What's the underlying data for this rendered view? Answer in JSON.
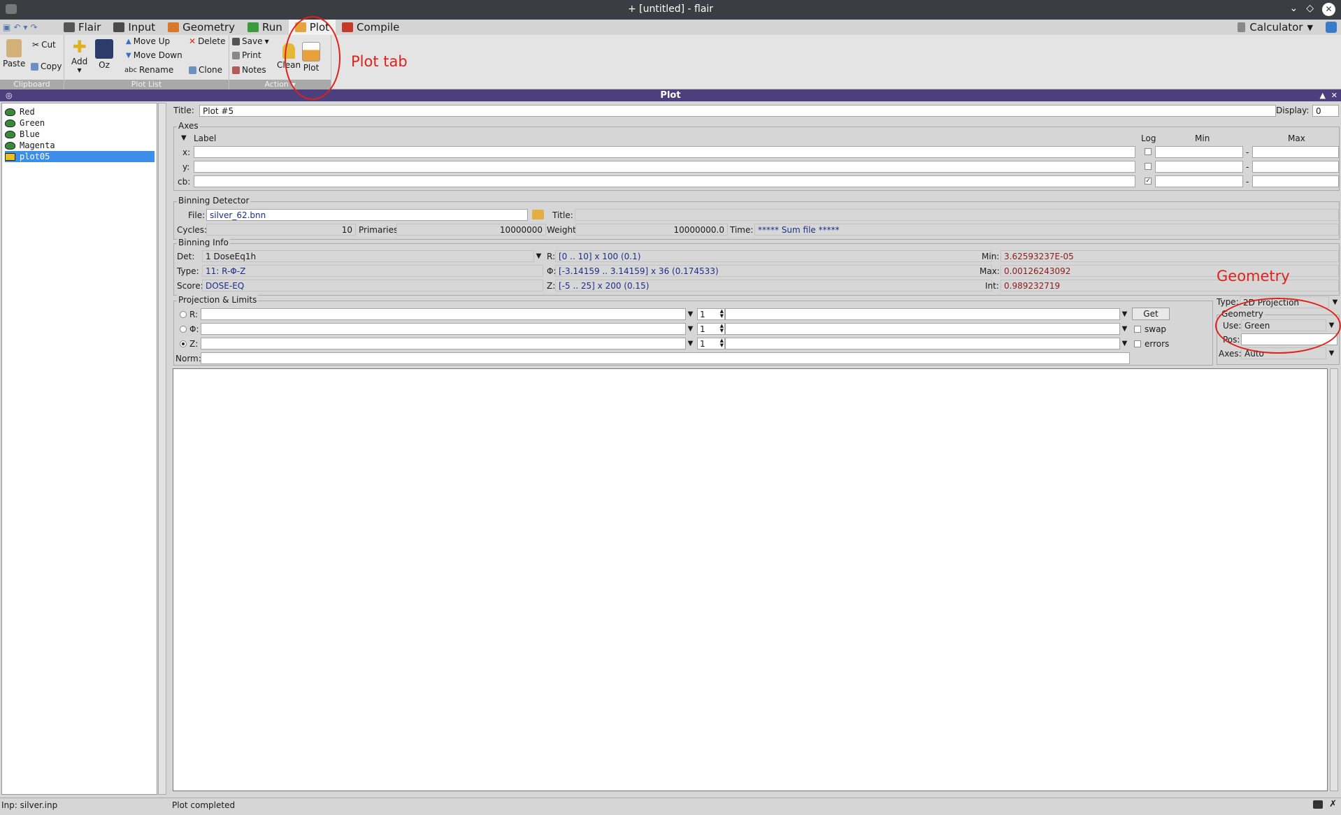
{
  "window": {
    "title": "+ [untitled] - flair"
  },
  "menubar": {
    "tabs": [
      {
        "label": "Flair",
        "color": "#555555"
      },
      {
        "label": "Input",
        "color": "#4a4a4a"
      },
      {
        "label": "Geometry",
        "color": "#d9772b"
      },
      {
        "label": "Run",
        "color": "#3b9a3b"
      },
      {
        "label": "Plot",
        "color": "#e6a23c"
      },
      {
        "label": "Compile",
        "color": "#c43a2a"
      }
    ],
    "calculator": "Calculator"
  },
  "ribbon": {
    "clipboard": {
      "paste": "Paste",
      "cut": "Cut",
      "copy": "Copy",
      "group": "Clipboard"
    },
    "plotlist": {
      "add": "Add",
      "oz": "Oz",
      "move_up": "Move Up",
      "move_down": "Move Down",
      "rename": "Rename",
      "delete": "Delete",
      "clone": "Clone",
      "group": "Plot List"
    },
    "action": {
      "save": "Save",
      "print": "Print",
      "notes": "Notes",
      "clean": "Clean",
      "plot": "Plot",
      "group": "Action"
    }
  },
  "panel": {
    "title": "Plot"
  },
  "plot_list": [
    {
      "label": "Red",
      "color": "#3a8a3a"
    },
    {
      "label": "Green",
      "color": "#3a8a3a"
    },
    {
      "label": "Blue",
      "color": "#3a8a3a"
    },
    {
      "label": "Magenta",
      "color": "#3a8a3a"
    },
    {
      "label": "plot05",
      "color": "#e8c020",
      "selected": true
    }
  ],
  "header": {
    "title_label": "Title:",
    "title_value": "Plot #5",
    "display_label": "Display:",
    "display_value": "0"
  },
  "axes": {
    "legend": "Axes",
    "label_col": "Label",
    "log_col": "Log",
    "min_col": "Min",
    "max_col": "Max",
    "rows": [
      {
        "name": "x:",
        "log": false
      },
      {
        "name": "y:",
        "log": false
      },
      {
        "name": "cb:",
        "log": true
      }
    ],
    "dash": "-"
  },
  "binning_detector": {
    "legend": "Binning Detector",
    "file_label": "File:",
    "file": "silver_62.bnn",
    "title_label": "Title:",
    "cycles_label": "Cycles:",
    "cycles": "10",
    "primaries_label": "Primaries:",
    "primaries": "10000000",
    "weight_label": "Weight:",
    "weight": "10000000.0",
    "time_label": "Time:",
    "time": "***** Sum file *****"
  },
  "binning_info": {
    "legend": "Binning Info",
    "det_label": "Det:",
    "det": "1 DoseEq1h",
    "type_label": "Type:",
    "type": "11: R-Φ-Z",
    "score_label": "Score:",
    "score": "DOSE-EQ",
    "r_label": "R:",
    "r": "[0 .. 10] x 100 (0.1)",
    "phi_label": "Φ:",
    "phi": "[-3.14159 .. 3.14159] x 36 (0.174533)",
    "z_label": "Z:",
    "z": "[-5 .. 25] x 200 (0.15)",
    "min_label": "Min:",
    "min": "3.62593237E-05",
    "max_label": "Max:",
    "max": "0.00126243092",
    "int_label": "Int:",
    "int": "0.989232719"
  },
  "projection": {
    "legend": "Projection & Limits",
    "rows": [
      {
        "label": "R:",
        "spin": "1",
        "selected": false
      },
      {
        "label": "Φ:",
        "spin": "1",
        "selected": false
      },
      {
        "label": "Z:",
        "spin": "1",
        "selected": true
      }
    ],
    "norm_label": "Norm:",
    "get": "Get",
    "swap": "swap",
    "errors": "errors"
  },
  "geometry": {
    "type_label": "Type:",
    "type": "2D Projection",
    "legend": "Geometry",
    "use_label": "Use:",
    "use": "Green",
    "pos_label": "Pos:",
    "axes_label": "Axes:",
    "axes": "Auto"
  },
  "annotations": {
    "plot_tab": "Plot tab",
    "geometry": "Geometry",
    "color": "#e0201b"
  },
  "status": {
    "left": "Inp: silver.inp",
    "message": "Plot completed"
  }
}
